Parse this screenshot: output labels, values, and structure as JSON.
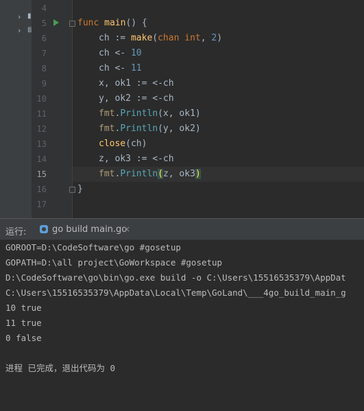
{
  "editor": {
    "line_numbers": [
      "4",
      "5",
      "6",
      "7",
      "8",
      "9",
      "10",
      "11",
      "12",
      "13",
      "14",
      "15",
      "16",
      "17"
    ],
    "current_line": "15",
    "code": {
      "l5": {
        "kw": "func",
        "name": "main",
        "rest": "() {"
      },
      "l6": {
        "a": "ch := ",
        "make": "make",
        "b": "(",
        "chan": "chan",
        "sp": " ",
        "int": "int",
        "c": ", ",
        "n": "2",
        "d": ")"
      },
      "l7": {
        "a": "ch <- ",
        "n": "10"
      },
      "l8": {
        "a": "ch <- ",
        "n": "11"
      },
      "l9": "x, ok1 := <-ch",
      "l10": "y, ok2 := <-ch",
      "l11": {
        "pkg": "fmt",
        "dot": ".",
        "fn": "Println",
        "args": "(x, ok1)"
      },
      "l12": {
        "pkg": "fmt",
        "dot": ".",
        "fn": "Println",
        "args": "(y, ok2)"
      },
      "l13": {
        "fn": "close",
        "args": "(ch)"
      },
      "l14": "z, ok3 := <-ch",
      "l15": {
        "pkg": "fmt",
        "dot": ".",
        "fn": "Println",
        "open": "(",
        "args": "z, ok3",
        "close": ")"
      },
      "l16": "}"
    }
  },
  "run_panel": {
    "label": "运行:",
    "tab": {
      "label": "go build main.go",
      "close": "×"
    },
    "output": [
      "GOROOT=D:\\CodeSoftware\\go #gosetup",
      "GOPATH=D:\\all project\\GoWorkspace #gosetup",
      "D:\\CodeSoftware\\go\\bin\\go.exe build -o C:\\Users\\15516535379\\AppDat",
      "C:\\Users\\15516535379\\AppData\\Local\\Temp\\GoLand\\___4go_build_main_g",
      "10 true",
      "11 true",
      "0 false",
      "",
      "进程 已完成，退出代码为 0"
    ]
  },
  "icons": {
    "run": "run-triangle-icon",
    "fold": "fold-marker-icon",
    "go_file": "go-file-icon"
  },
  "colors": {
    "keyword": "#cc7832",
    "function": "#ffc66d",
    "number": "#6897bb",
    "run": "#499c54"
  }
}
